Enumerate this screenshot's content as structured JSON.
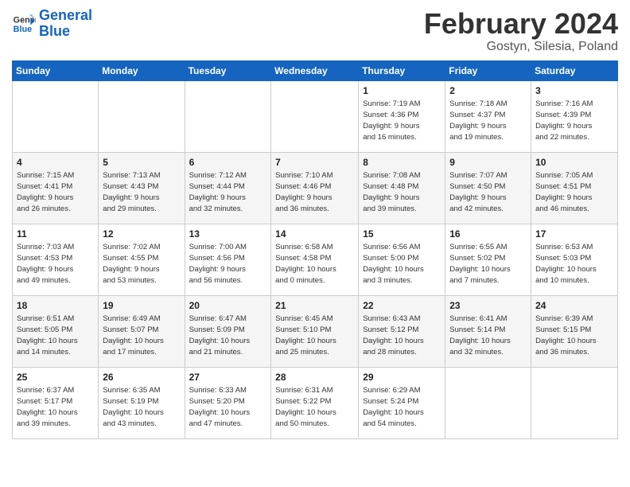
{
  "logo": {
    "line1": "General",
    "line2": "Blue"
  },
  "calendar": {
    "title": "February 2024",
    "subtitle": "Gostyn, Silesia, Poland"
  },
  "days_of_week": [
    "Sunday",
    "Monday",
    "Tuesday",
    "Wednesday",
    "Thursday",
    "Friday",
    "Saturday"
  ],
  "weeks": [
    [
      {
        "num": "",
        "info": ""
      },
      {
        "num": "",
        "info": ""
      },
      {
        "num": "",
        "info": ""
      },
      {
        "num": "",
        "info": ""
      },
      {
        "num": "1",
        "info": "Sunrise: 7:19 AM\nSunset: 4:36 PM\nDaylight: 9 hours\nand 16 minutes."
      },
      {
        "num": "2",
        "info": "Sunrise: 7:18 AM\nSunset: 4:37 PM\nDaylight: 9 hours\nand 19 minutes."
      },
      {
        "num": "3",
        "info": "Sunrise: 7:16 AM\nSunset: 4:39 PM\nDaylight: 9 hours\nand 22 minutes."
      }
    ],
    [
      {
        "num": "4",
        "info": "Sunrise: 7:15 AM\nSunset: 4:41 PM\nDaylight: 9 hours\nand 26 minutes."
      },
      {
        "num": "5",
        "info": "Sunrise: 7:13 AM\nSunset: 4:43 PM\nDaylight: 9 hours\nand 29 minutes."
      },
      {
        "num": "6",
        "info": "Sunrise: 7:12 AM\nSunset: 4:44 PM\nDaylight: 9 hours\nand 32 minutes."
      },
      {
        "num": "7",
        "info": "Sunrise: 7:10 AM\nSunset: 4:46 PM\nDaylight: 9 hours\nand 36 minutes."
      },
      {
        "num": "8",
        "info": "Sunrise: 7:08 AM\nSunset: 4:48 PM\nDaylight: 9 hours\nand 39 minutes."
      },
      {
        "num": "9",
        "info": "Sunrise: 7:07 AM\nSunset: 4:50 PM\nDaylight: 9 hours\nand 42 minutes."
      },
      {
        "num": "10",
        "info": "Sunrise: 7:05 AM\nSunset: 4:51 PM\nDaylight: 9 hours\nand 46 minutes."
      }
    ],
    [
      {
        "num": "11",
        "info": "Sunrise: 7:03 AM\nSunset: 4:53 PM\nDaylight: 9 hours\nand 49 minutes."
      },
      {
        "num": "12",
        "info": "Sunrise: 7:02 AM\nSunset: 4:55 PM\nDaylight: 9 hours\nand 53 minutes."
      },
      {
        "num": "13",
        "info": "Sunrise: 7:00 AM\nSunset: 4:56 PM\nDaylight: 9 hours\nand 56 minutes."
      },
      {
        "num": "14",
        "info": "Sunrise: 6:58 AM\nSunset: 4:58 PM\nDaylight: 10 hours\nand 0 minutes."
      },
      {
        "num": "15",
        "info": "Sunrise: 6:56 AM\nSunset: 5:00 PM\nDaylight: 10 hours\nand 3 minutes."
      },
      {
        "num": "16",
        "info": "Sunrise: 6:55 AM\nSunset: 5:02 PM\nDaylight: 10 hours\nand 7 minutes."
      },
      {
        "num": "17",
        "info": "Sunrise: 6:53 AM\nSunset: 5:03 PM\nDaylight: 10 hours\nand 10 minutes."
      }
    ],
    [
      {
        "num": "18",
        "info": "Sunrise: 6:51 AM\nSunset: 5:05 PM\nDaylight: 10 hours\nand 14 minutes."
      },
      {
        "num": "19",
        "info": "Sunrise: 6:49 AM\nSunset: 5:07 PM\nDaylight: 10 hours\nand 17 minutes."
      },
      {
        "num": "20",
        "info": "Sunrise: 6:47 AM\nSunset: 5:09 PM\nDaylight: 10 hours\nand 21 minutes."
      },
      {
        "num": "21",
        "info": "Sunrise: 6:45 AM\nSunset: 5:10 PM\nDaylight: 10 hours\nand 25 minutes."
      },
      {
        "num": "22",
        "info": "Sunrise: 6:43 AM\nSunset: 5:12 PM\nDaylight: 10 hours\nand 28 minutes."
      },
      {
        "num": "23",
        "info": "Sunrise: 6:41 AM\nSunset: 5:14 PM\nDaylight: 10 hours\nand 32 minutes."
      },
      {
        "num": "24",
        "info": "Sunrise: 6:39 AM\nSunset: 5:15 PM\nDaylight: 10 hours\nand 36 minutes."
      }
    ],
    [
      {
        "num": "25",
        "info": "Sunrise: 6:37 AM\nSunset: 5:17 PM\nDaylight: 10 hours\nand 39 minutes."
      },
      {
        "num": "26",
        "info": "Sunrise: 6:35 AM\nSunset: 5:19 PM\nDaylight: 10 hours\nand 43 minutes."
      },
      {
        "num": "27",
        "info": "Sunrise: 6:33 AM\nSunset: 5:20 PM\nDaylight: 10 hours\nand 47 minutes."
      },
      {
        "num": "28",
        "info": "Sunrise: 6:31 AM\nSunset: 5:22 PM\nDaylight: 10 hours\nand 50 minutes."
      },
      {
        "num": "29",
        "info": "Sunrise: 6:29 AM\nSunset: 5:24 PM\nDaylight: 10 hours\nand 54 minutes."
      },
      {
        "num": "",
        "info": ""
      },
      {
        "num": "",
        "info": ""
      }
    ]
  ]
}
